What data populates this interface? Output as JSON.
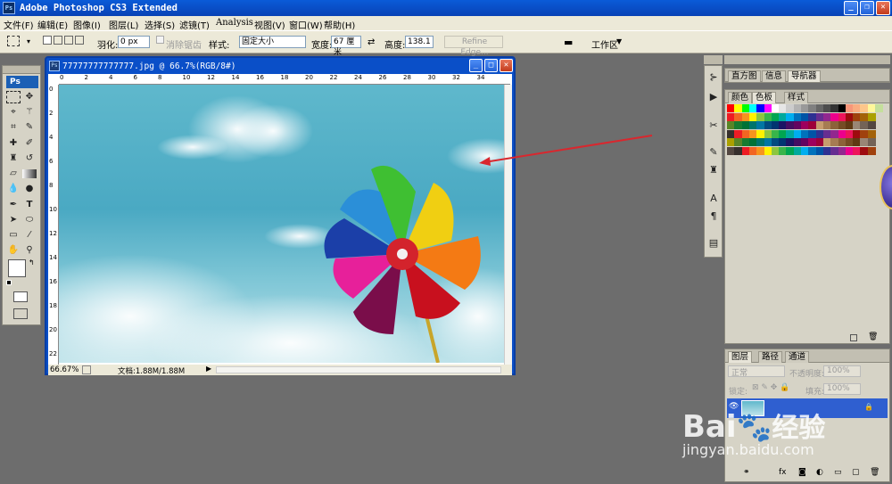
{
  "app": {
    "ps_badge": "Ps",
    "title": "Adobe Photoshop CS3 Extended"
  },
  "menu": [
    "文件(F)",
    "编辑(E)",
    "图像(I)",
    "图层(L)",
    "选择(S)",
    "滤镜(T)",
    "Analysis",
    "视图(V)",
    "窗口(W)",
    "帮助(H)"
  ],
  "options": {
    "feather_label": "羽化:",
    "feather_value": "0 px",
    "antialias_label": "消除锯齿",
    "style_label": "样式:",
    "style_value": "固定大小",
    "width_label": "宽度:",
    "width_value": "67 厘米",
    "height_label": "高度:",
    "height_value": "138.1",
    "refine_edge": "Refine Edge...",
    "workspace": "工作区"
  },
  "document": {
    "title": "77777777777777.jpg @ 66.7%(RGB/8#)",
    "zoom": "66.67%",
    "doc_info": "文档:1.88M/1.88M",
    "ruler_ticks": [
      "0",
      "2",
      "4",
      "6",
      "8",
      "10",
      "12",
      "14",
      "16",
      "18",
      "20",
      "22",
      "24",
      "26",
      "28",
      "30",
      "32",
      "34"
    ],
    "vruler_ticks": [
      "0",
      "2",
      "4",
      "6",
      "8",
      "10",
      "12",
      "14",
      "16",
      "18",
      "20",
      "22"
    ]
  },
  "panels": {
    "top_tabs": [
      "直方图",
      "信息",
      "导航器"
    ],
    "color_tabs": [
      "颜色",
      "色板",
      "样式"
    ],
    "layer_tabs": [
      "图层",
      "路径",
      "通道"
    ],
    "blend_mode": "正常",
    "opacity_label": "不透明度:",
    "opacity_value": "100%",
    "lock_label": "锁定:",
    "fill_label": "填充:",
    "fill_value": "100%"
  },
  "watermark": {
    "brand": "Bai",
    "brand2": "经验",
    "url": "jingyan.baidu.com"
  },
  "colors": {
    "titlebar": "#0a4fc8",
    "arrow": "#d9272e",
    "layer_selected": "#2f5fd0"
  }
}
